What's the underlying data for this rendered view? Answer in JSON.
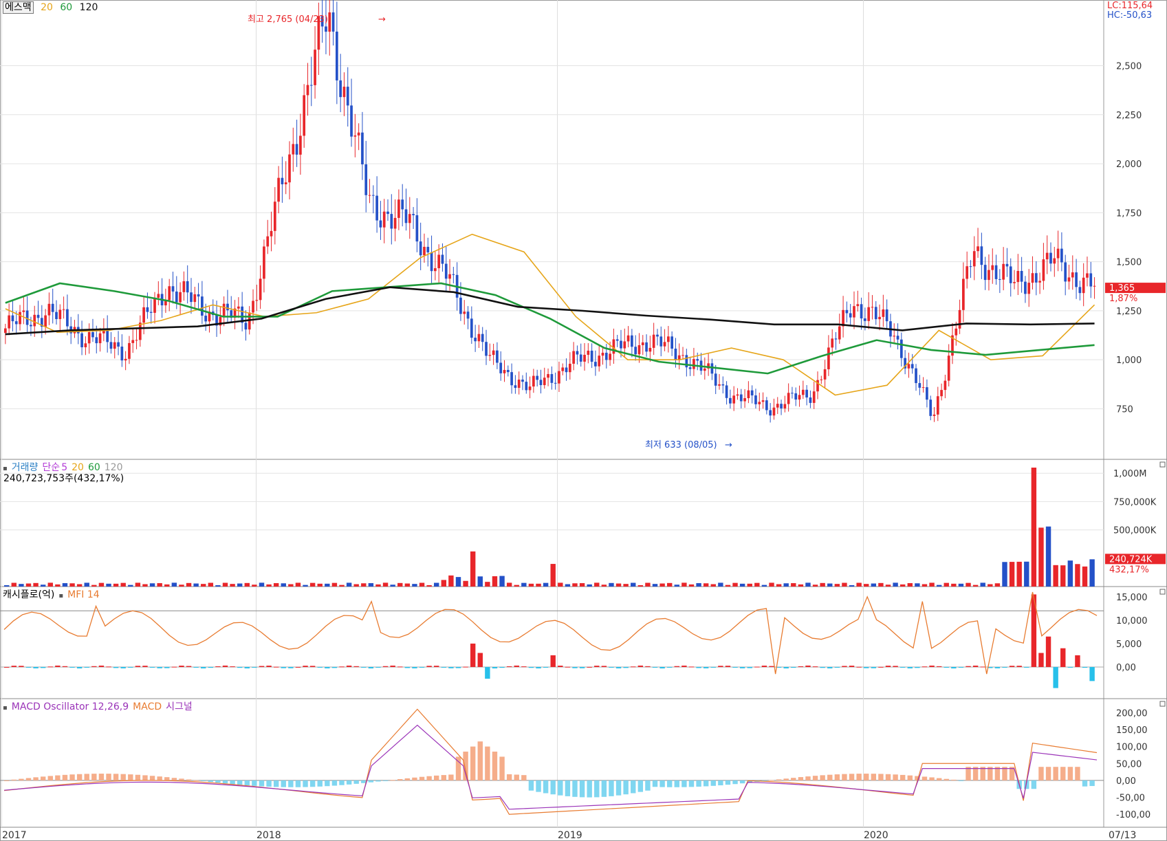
{
  "header": {
    "stock_name": "에스맥",
    "ma_labels": [
      "20",
      "60",
      "120"
    ],
    "lc": "LC:115,64",
    "hc": "HC:-50,63",
    "high_marker": "최고 2,765 (04/23)",
    "low_marker": "최저 633 (08/05)",
    "last_price": "1,365",
    "last_change": "1,87%"
  },
  "volume_panel": {
    "title": "거래량",
    "ma_title": "단순",
    "ma_labels": [
      "5",
      "20",
      "60",
      "120"
    ],
    "value_text": "240,723,753주(432,17%)",
    "last_volume": "240,724K",
    "last_change": "432,17%"
  },
  "mfi_panel": {
    "title": "캐시플로(억)",
    "indicator": "MFI 14"
  },
  "macd_panel": {
    "title": "MACD Oscillator 12,26,9",
    "macd": "MACD",
    "signal": "시그널"
  },
  "colors": {
    "up": "#e8262a",
    "down": "#2451c8",
    "ma20": "#e6a519",
    "ma60": "#1e9a3a",
    "ma120": "#111111",
    "mfi_line": "#e87b30",
    "macd_osc": "#f5ad8a",
    "macd_osc_neg": "#7fd6f0",
    "macd_line": "#e87b30",
    "signal_line": "#9a33b8",
    "cash_pos": "#e8262a",
    "cash_neg": "#27c0ea",
    "vol_ma5": "#b23ad6"
  },
  "chart_data": [
    {
      "type": "candlestick",
      "panel": "price",
      "x_labels": [
        "2017",
        "2018",
        "2019",
        "2020",
        "07/13"
      ],
      "y_ticks": [
        "750",
        "1,000",
        "1,250",
        "1,500",
        "1,750",
        "2,000",
        "2,250",
        "2,500"
      ],
      "ylim": [
        520,
        2800
      ],
      "key_prices": [
        1160,
        1250,
        1120,
        1050,
        1380,
        1250,
        1200,
        2000,
        2765,
        1800,
        1700,
        1400,
        1000,
        850,
        980,
        1050,
        1100,
        1000,
        820,
        760,
        830,
        1300,
        1150,
        700,
        1550,
        1380,
        1500,
        1365
      ],
      "series": [
        {
          "name": "20",
          "values": [
            1260,
            1140,
            1150,
            1200,
            1280,
            1220,
            1240,
            1310,
            1520,
            1640,
            1550,
            1220,
            1000,
            1000,
            1060,
            1000,
            820,
            870,
            1150,
            1000,
            1020,
            1280
          ]
        },
        {
          "name": "60",
          "values": [
            1290,
            1390,
            1350,
            1300,
            1220,
            1220,
            1350,
            1370,
            1390,
            1330,
            1210,
            1060,
            990,
            960,
            930,
            1020,
            1100,
            1050,
            1025,
            1050,
            1075
          ]
        },
        {
          "name": "120",
          "values": [
            1130,
            1150,
            1160,
            1170,
            1210,
            1310,
            1370,
            1345,
            1270,
            1250,
            1225,
            1205,
            1180,
            1180,
            1150,
            1185,
            1180,
            1185
          ]
        }
      ]
    },
    {
      "type": "bar",
      "panel": "volume",
      "y_ticks": [
        "500,000K",
        "750,000K",
        "1,000M"
      ],
      "ylim": [
        0,
        1050000
      ],
      "peak_values_k": [
        60000,
        310000,
        1050000,
        530000,
        240724
      ]
    },
    {
      "type": "bar",
      "panel": "cashflow_mfi",
      "y_ticks": [
        "0,00",
        "5,000",
        "10,000",
        "15,000"
      ],
      "ylim": [
        -5000,
        16000
      ]
    },
    {
      "type": "bar",
      "panel": "macd",
      "y_ticks": [
        "-100,00",
        "-50,00",
        "0,00",
        "50,00",
        "100,00",
        "150,00",
        "200,00"
      ],
      "ylim": [
        -130,
        225
      ]
    }
  ]
}
